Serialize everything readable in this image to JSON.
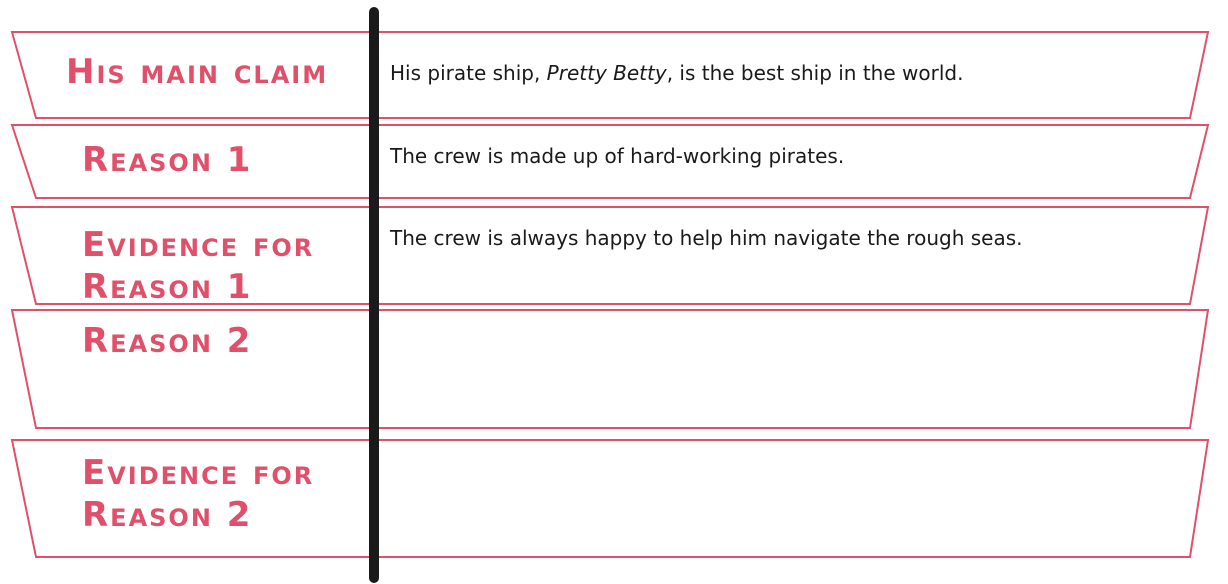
{
  "colors": {
    "label": "#e0506a",
    "outline": "#e0506a",
    "divider": "#1a1a1a",
    "text": "#1a1a1a"
  },
  "rows": {
    "main_claim": {
      "label": "His main claim",
      "entry_before": "His pirate ship, ",
      "entry_title": "Pretty Betty",
      "entry_after": ", is the best ship in the world."
    },
    "reason_1": {
      "label": "Reason 1",
      "entry": "The crew is made up of hard-working pirates."
    },
    "evidence_1": {
      "label_line1": "Evidence for",
      "label_line2": "Reason 1",
      "entry": "The crew is always happy to help him navigate the rough seas."
    },
    "reason_2": {
      "label": "Reason 2",
      "entry": ""
    },
    "evidence_2": {
      "label_line1": "Evidence for",
      "label_line2": "Reason 2",
      "entry": ""
    }
  }
}
